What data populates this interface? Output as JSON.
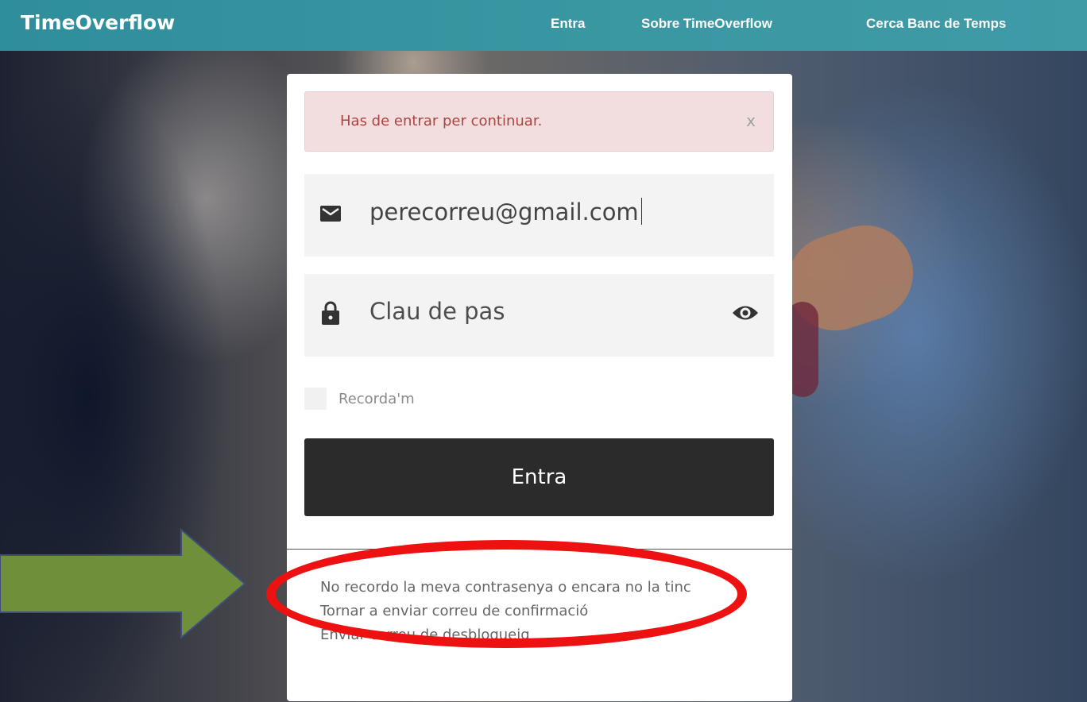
{
  "navbar": {
    "brand": "TimeOverflow",
    "links": [
      "Entra",
      "Sobre TimeOverflow",
      "Cerca Banc de Temps"
    ]
  },
  "alert": {
    "message": "Has de entrar per continuar.",
    "close": "x"
  },
  "form": {
    "email": {
      "icon": "envelope-icon",
      "value": "perecorreu@gmail.com"
    },
    "password": {
      "icon": "lock-icon",
      "placeholder": "Clau de pas",
      "toggle_icon": "eye-icon"
    },
    "remember_label": "Recorda'm",
    "submit_label": "Entra"
  },
  "links": [
    "No recordo la meva contrasenya o encara no la tinc",
    "Tornar a enviar correu de confirmació",
    "Enviar correu de desbloqueig"
  ],
  "colors": {
    "navbar": "#3a98a3",
    "alert_bg": "#f2dede",
    "alert_text": "#a94442",
    "button_bg": "#2b2b2b",
    "annotation_arrow": "#6f8f3a",
    "annotation_ellipse": "#ee1111"
  }
}
